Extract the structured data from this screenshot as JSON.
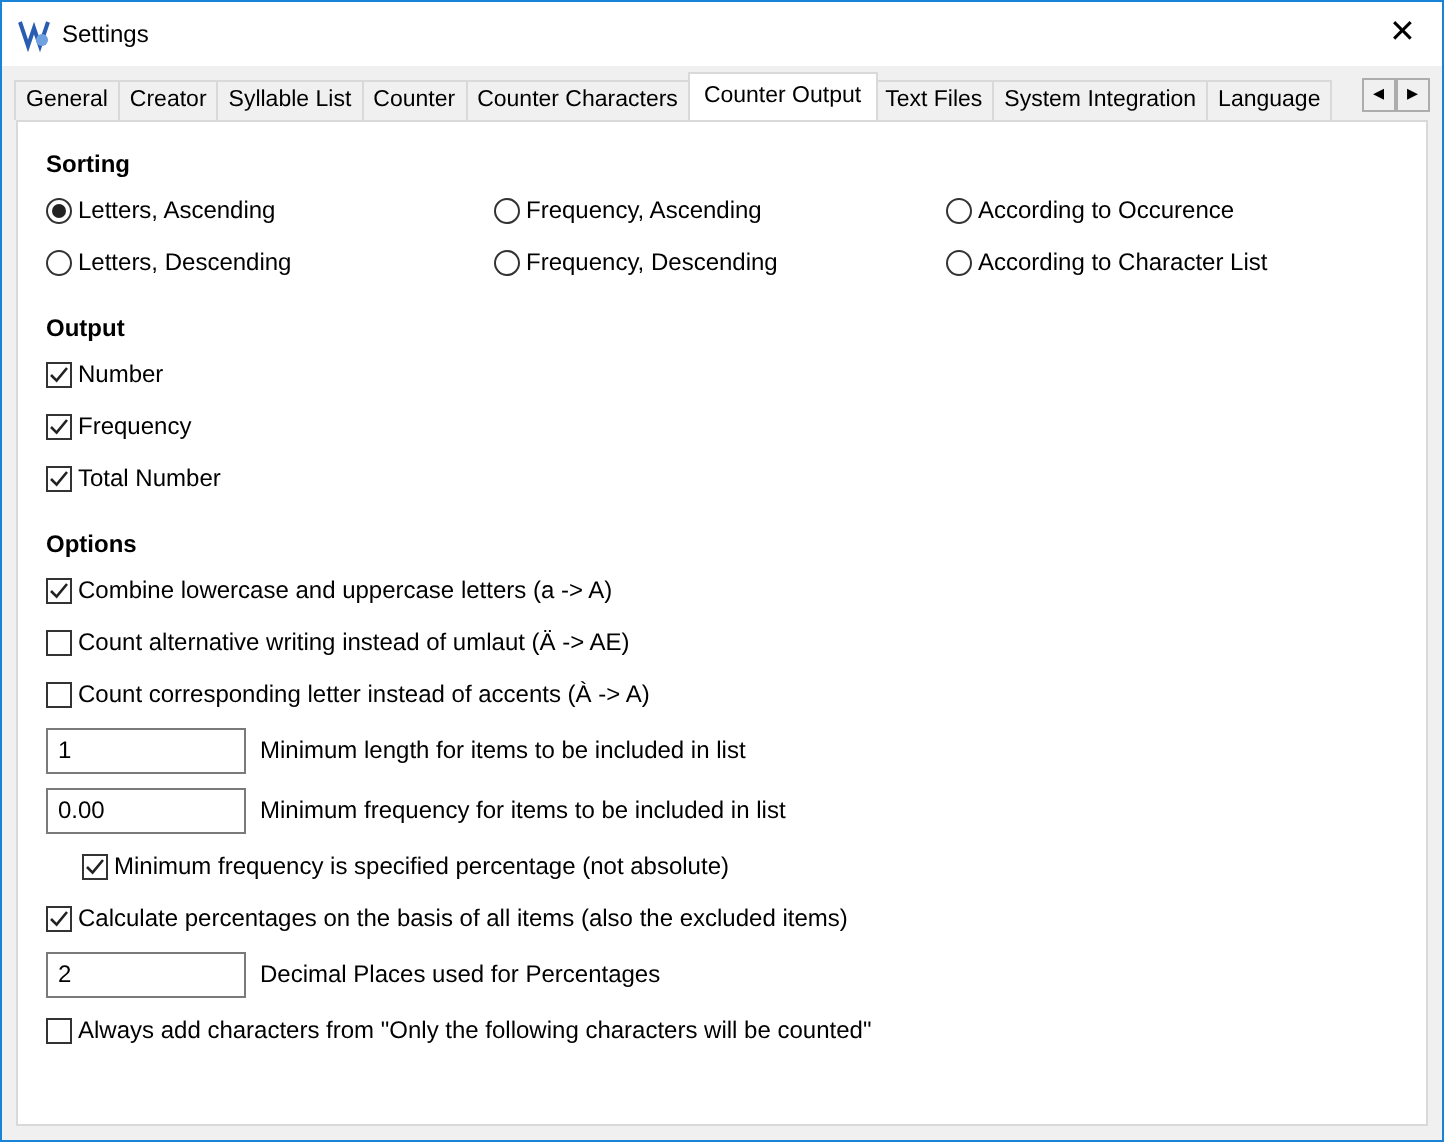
{
  "window": {
    "title": "Settings",
    "close": "✕"
  },
  "tabs": [
    {
      "label": "General",
      "selected": false
    },
    {
      "label": "Creator",
      "selected": false
    },
    {
      "label": "Syllable List",
      "selected": false
    },
    {
      "label": "Counter",
      "selected": false
    },
    {
      "label": "Counter Characters",
      "selected": false
    },
    {
      "label": "Counter Output",
      "selected": true
    },
    {
      "label": "Text Files",
      "selected": false
    },
    {
      "label": "System Integration",
      "selected": false
    },
    {
      "label": "Language",
      "selected": false
    }
  ],
  "tab_scroll": [
    "◂",
    "▸"
  ],
  "sorting": {
    "heading": "Sorting",
    "options": [
      {
        "label": "Letters, Ascending",
        "selected": true
      },
      {
        "label": "Frequency, Ascending",
        "selected": false
      },
      {
        "label": "According to Occurence",
        "selected": false
      },
      {
        "label": "Letters, Descending",
        "selected": false
      },
      {
        "label": "Frequency, Descending",
        "selected": false
      },
      {
        "label": "According to Character List",
        "selected": false
      }
    ]
  },
  "output": {
    "heading": "Output",
    "items": [
      {
        "label": "Number",
        "checked": true
      },
      {
        "label": "Frequency",
        "checked": true
      },
      {
        "label": "Total Number",
        "checked": true
      }
    ]
  },
  "options": {
    "heading": "Options",
    "items": [
      {
        "kind": "checkbox",
        "label": "Combine lowercase and uppercase letters (a -> A)",
        "checked": true
      },
      {
        "kind": "checkbox",
        "label": "Count alternative writing instead of umlaut (Ä -> AE)",
        "checked": false
      },
      {
        "kind": "checkbox",
        "label": "Count corresponding letter instead of accents (À -> A)",
        "checked": false
      },
      {
        "kind": "input",
        "field": {
          "value": "1"
        },
        "label": "Minimum length for items to be included in list"
      },
      {
        "kind": "input",
        "field": {
          "value": "0.00"
        },
        "label": "Minimum frequency for items to be included in list"
      },
      {
        "kind": "subcheckbox",
        "label": "Minimum frequency is specified percentage (not absolute)",
        "checked": true
      },
      {
        "kind": "checkbox",
        "label": "Calculate percentages on the basis of all items (also the excluded items)",
        "checked": true
      },
      {
        "kind": "input",
        "field": {
          "value": "2"
        },
        "label": "Decimal Places used for Percentages"
      },
      {
        "kind": "checkbox",
        "label": "Always add characters from \"Only the following characters will be counted\"",
        "checked": false
      }
    ]
  }
}
